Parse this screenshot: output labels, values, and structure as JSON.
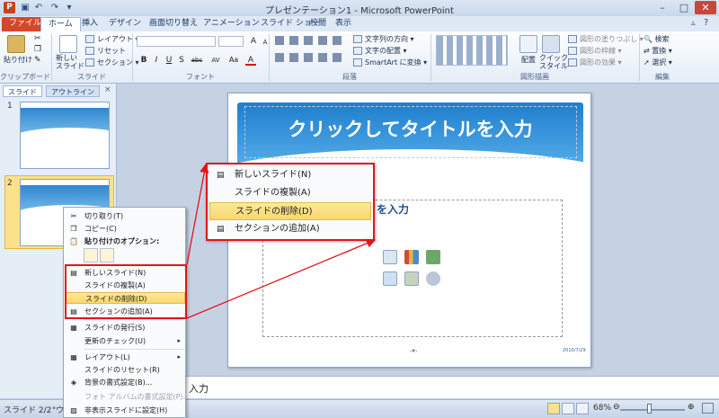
{
  "window": {
    "title": "プレゼンテーション1 - Microsoft PowerPoint",
    "app_icon": "P"
  },
  "quick_access": {
    "save_icon": "save-icon",
    "undo_icon": "undo-icon",
    "redo_icon": "redo-icon"
  },
  "tabs": [
    "ファイル",
    "ホーム",
    "挿入",
    "デザイン",
    "画面切り替え",
    "アニメーション",
    "スライド ショー",
    "校閲",
    "表示"
  ],
  "ribbon": {
    "clipboard": {
      "paste": "貼り付け",
      "group": "クリップボード"
    },
    "slides": {
      "new_slide": "新しい\nスライド",
      "layout": "レイアウト ▾",
      "reset": "リセット",
      "section": "セクション ▾",
      "group": "スライド"
    },
    "font": {
      "bold": "B",
      "italic": "I",
      "underline": "U",
      "shadow": "S",
      "strike": "abc",
      "spacing": "AV",
      "case": "Aa",
      "color": "A",
      "grow": "A",
      "shrink": "A",
      "group": "フォント"
    },
    "paragraph": {
      "direction": "文字列の方向 ▾",
      "align": "文字の配置 ▾",
      "smartart": "SmartArt に変換 ▾",
      "group": "段落"
    },
    "drawing": {
      "arrange": "配置",
      "quick_styles": "クイック\nスタイル",
      "fill": "図形の塗りつぶし ▾",
      "outline": "図形の枠線 ▾",
      "effects": "図形の効果 ▾",
      "group": "図形描画"
    },
    "editing": {
      "find": "検索",
      "replace": "置換 ▾",
      "select": "選択 ▾",
      "group": "編集"
    }
  },
  "pane": {
    "tab_slides": "スライド",
    "tab_outline": "アウトライン",
    "close": "×",
    "thumbs": [
      "1",
      "2"
    ]
  },
  "slide": {
    "title": "クリックしてタイトルを入力",
    "body_fragment": "を入力",
    "footer_num": "‹#›",
    "footer_date": "2010/7/29"
  },
  "notes": {
    "text": "入力"
  },
  "status": {
    "slide": "スライド 2/2",
    "lang": "\"ウ",
    "zoom": "68%",
    "zoom_fraction": 0.45
  },
  "context_menu": {
    "items": [
      {
        "label": "切り取り(T)",
        "icon": "✂"
      },
      {
        "label": "コピー(C)",
        "icon": "❐"
      },
      {
        "label": "貼り付けのオプション:",
        "icon": "📋"
      },
      {
        "label": "新しいスライド(N)",
        "icon": "▤"
      },
      {
        "label": "スライドの複製(A)",
        "icon": ""
      },
      {
        "label": "スライドの削除(D)",
        "icon": ""
      },
      {
        "label": "セクションの追加(A)",
        "icon": "▤"
      },
      {
        "label": "スライドの発行(S)",
        "icon": "▦"
      },
      {
        "label": "更新のチェック(U)",
        "icon": ""
      },
      {
        "label": "レイアウト(L)",
        "icon": "▦"
      },
      {
        "label": "スライドのリセット(R)",
        "icon": ""
      },
      {
        "label": "背景の書式設定(B)...",
        "icon": "◈"
      },
      {
        "label": "フォト アルバムの書式設定(P)...",
        "icon": ""
      },
      {
        "label": "非表示スライドに設定(H)",
        "icon": "▨"
      }
    ],
    "submenu_arrow": "▸"
  },
  "zoom_callout": {
    "items": [
      {
        "label": "新しいスライド(N)"
      },
      {
        "label": "スライドの複製(A)"
      },
      {
        "label": "スライドの削除(D)"
      },
      {
        "label": "セクションの追加(A)"
      }
    ]
  },
  "colors": {
    "highlight": "#f9d76a",
    "callout_red": "#e3141b",
    "file_tab": "#d4482a",
    "slide_blue": "#1f7fcf"
  }
}
